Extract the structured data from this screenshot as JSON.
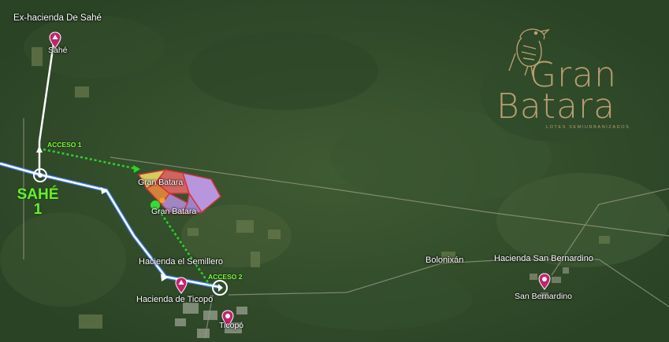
{
  "map": {
    "places": {
      "ex_hacienda": "Ex-hacienda De Sahé",
      "sahe": "Sahé",
      "hacienda_semillero": "Hacienda el Semillero",
      "hacienda_ticopo": "Hacienda de Ticopó",
      "ticopo": "Ticopó",
      "bolonixan": "Bolonixán",
      "hacienda_san_bernardino": "Hacienda San Bernardino",
      "san_bernardino": "San Bernardino",
      "gran_batara_1": "Gran Batara",
      "gran_batara_2": "Gran Batara"
    },
    "access_points": {
      "acceso_1": "ACCESO 1",
      "acceso_2": "ACCESO 2"
    },
    "sahe_marker": {
      "line1": "SAHÉ",
      "line2": "1"
    },
    "pin_icon": "map-pin-icon",
    "colors": {
      "route": "#ffffff",
      "highway": "#3f7fff",
      "access_path": "#2bd42b",
      "pin": "#c0246d",
      "sahe_text": "#66ee33",
      "logo": "#b89e72"
    }
  },
  "logo": {
    "line1": "Gran",
    "line2": "Batara",
    "tagline": "LOTES SEMIURBANIZADOS",
    "icon": "bird-logo-icon"
  }
}
